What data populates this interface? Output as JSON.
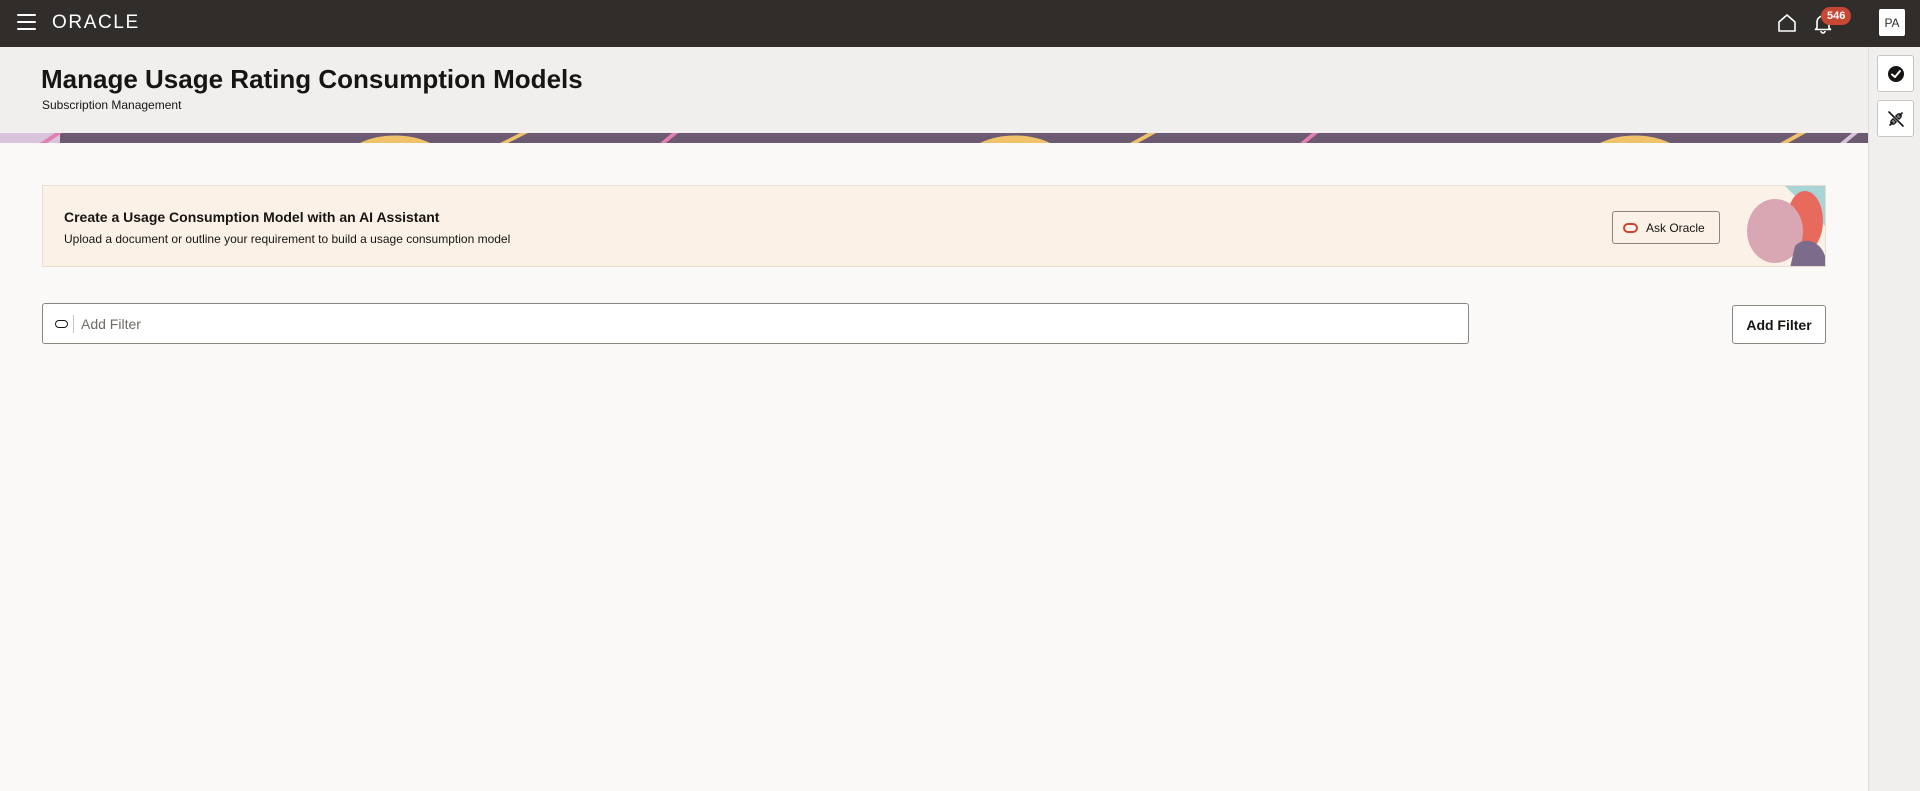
{
  "topbar": {
    "logo_text": "ORACLE",
    "notification_count": "546",
    "avatar_initials": "PA"
  },
  "header": {
    "title": "Manage Usage Rating Consumption Models",
    "subtitle": "Subscription Management"
  },
  "ai_card": {
    "title": "Create a Usage Consumption Model with an AI Assistant",
    "description": "Upload a document or outline your requirement to build a usage consumption model",
    "button_label": "Ask Oracle"
  },
  "filter": {
    "placeholder": "Add Filter",
    "button_label": "Add Filter"
  },
  "right_rail": {
    "items": [
      {
        "icon": "checkmark-circle-icon"
      },
      {
        "icon": "connection-off-icon"
      }
    ]
  },
  "colors": {
    "topbar_bg": "#312d2a",
    "badge": "#c74634",
    "ai_card_bg": "#fcf1e6",
    "page_bg": "#faf9f8"
  }
}
